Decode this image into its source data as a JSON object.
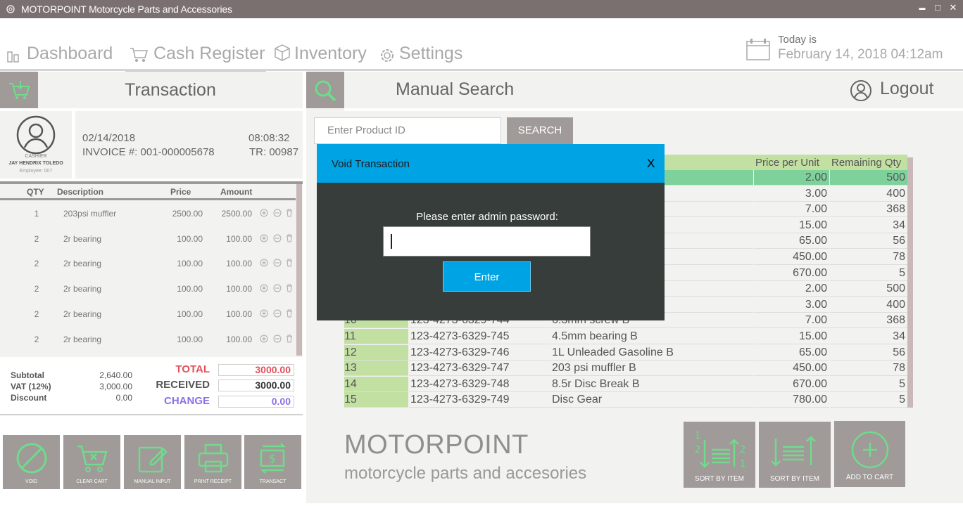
{
  "window": {
    "title": "MOTORPOINT Motorcycle Parts and Accessories",
    "minimize": "▬",
    "maximize": "□",
    "close": "✕"
  },
  "nav": {
    "dashboard": "Dashboard",
    "cash_register": "Cash Register",
    "inventory": "Inventory",
    "settings": "Settings"
  },
  "today": {
    "label": "Today is",
    "value": "February 14, 2018 04:12am"
  },
  "transaction": {
    "title": "Transaction",
    "cashier_role": "CASHIER",
    "cashier_name": "JAY HENDRIX TOLEDO",
    "employee": "Employee: 007",
    "date": "02/14/2018",
    "time": "08:08:32",
    "invoice": "INVOICE #: 001-000005678",
    "tr": "TR: 00987",
    "columns": [
      "QTY",
      "Description",
      "Price",
      "Amount"
    ],
    "items": [
      {
        "qty": "1",
        "desc": "203psi muffler",
        "price": "2500.00",
        "amount": "2500.00"
      },
      {
        "qty": "2",
        "desc": "2r bearing",
        "price": "100.00",
        "amount": "100.00"
      },
      {
        "qty": "2",
        "desc": "2r bearing",
        "price": "100.00",
        "amount": "100.00"
      },
      {
        "qty": "2",
        "desc": "2r bearing",
        "price": "100.00",
        "amount": "100.00"
      },
      {
        "qty": "2",
        "desc": "2r bearing",
        "price": "100.00",
        "amount": "100.00"
      },
      {
        "qty": "2",
        "desc": "2r bearing",
        "price": "100.00",
        "amount": "100.00"
      }
    ],
    "subtotal_label": "Subtotal",
    "subtotal": "2,640.00",
    "vat_label": "VAT (12%)",
    "vat": "3,000.00",
    "discount_label": "Discount",
    "discount": "0.00",
    "total_label": "TOTAL",
    "total": "3000.00",
    "received_label": "RECEIVED",
    "received": "3000.00",
    "change_label": "CHANGE",
    "change": "0.00"
  },
  "actions": {
    "void": "VOID",
    "clear_cart": "CLEAR CART",
    "manual_input": "MANUAL INPUT",
    "print_receipt": "PRINT RECEIPT",
    "transact": "TRANSACT"
  },
  "search": {
    "title": "Manual Search",
    "logout": "Logout",
    "placeholder": "Enter Product ID",
    "button": "SEARCH",
    "columns": {
      "price": "Price per Unit",
      "qty": "Remaining Qty"
    },
    "rows": [
      {
        "no": "",
        "id": "",
        "desc": "",
        "price": "2.00",
        "qty": "500"
      },
      {
        "no": "",
        "id": "",
        "desc": "",
        "price": "3.00",
        "qty": "400"
      },
      {
        "no": "",
        "id": "",
        "desc": "",
        "price": "7.00",
        "qty": "368"
      },
      {
        "no": "",
        "id": "",
        "desc": "",
        "price": "15.00",
        "qty": "34"
      },
      {
        "no": "",
        "id": "",
        "desc": "",
        "price": "65.00",
        "qty": "56"
      },
      {
        "no": "",
        "id": "",
        "desc": "",
        "price": "450.00",
        "qty": "78"
      },
      {
        "no": "",
        "id": "",
        "desc": "",
        "price": "670.00",
        "qty": "5"
      },
      {
        "no": "",
        "id": "",
        "desc": "",
        "price": "2.00",
        "qty": "500"
      },
      {
        "no": "",
        "id": "",
        "desc": "",
        "price": "3.00",
        "qty": "400"
      },
      {
        "no": "10",
        "id": "123-4273-6329-744",
        "desc": "6.3mm screw B",
        "price": "7.00",
        "qty": "368"
      },
      {
        "no": "11",
        "id": "123-4273-6329-745",
        "desc": "4.5mm bearing B",
        "price": "15.00",
        "qty": "34"
      },
      {
        "no": "12",
        "id": "123-4273-6329-746",
        "desc": "1L Unleaded Gasoline B",
        "price": "65.00",
        "qty": "56"
      },
      {
        "no": "13",
        "id": "123-4273-6329-747",
        "desc": "203 psi muffler B",
        "price": "450.00",
        "qty": "78"
      },
      {
        "no": "14",
        "id": "123-4273-6329-748",
        "desc": "8.5r Disc Break B",
        "price": "670.00",
        "qty": "5"
      },
      {
        "no": "15",
        "id": "123-4273-6329-749",
        "desc": "Disc Gear",
        "price": "780.00",
        "qty": "5"
      }
    ]
  },
  "brand": {
    "name": "MOTORPOINT",
    "tagline": "motorcycle parts and accesories"
  },
  "buttons": {
    "sort_1": "SORT BY ITEM",
    "sort_2": "SORT BY ITEM",
    "add_to_cart": "ADD TO CART"
  },
  "modal": {
    "title": "Void Transaction",
    "close": "X",
    "prompt": "Please enter admin password:",
    "password_value": "",
    "enter": "Enter"
  },
  "colors": {
    "accent_green": "#6fdc8c",
    "header_blue": "#00a3e4",
    "panel_gray": "#a09a98",
    "total_red": "#e4505a",
    "change_purple": "#8a6fe8"
  }
}
